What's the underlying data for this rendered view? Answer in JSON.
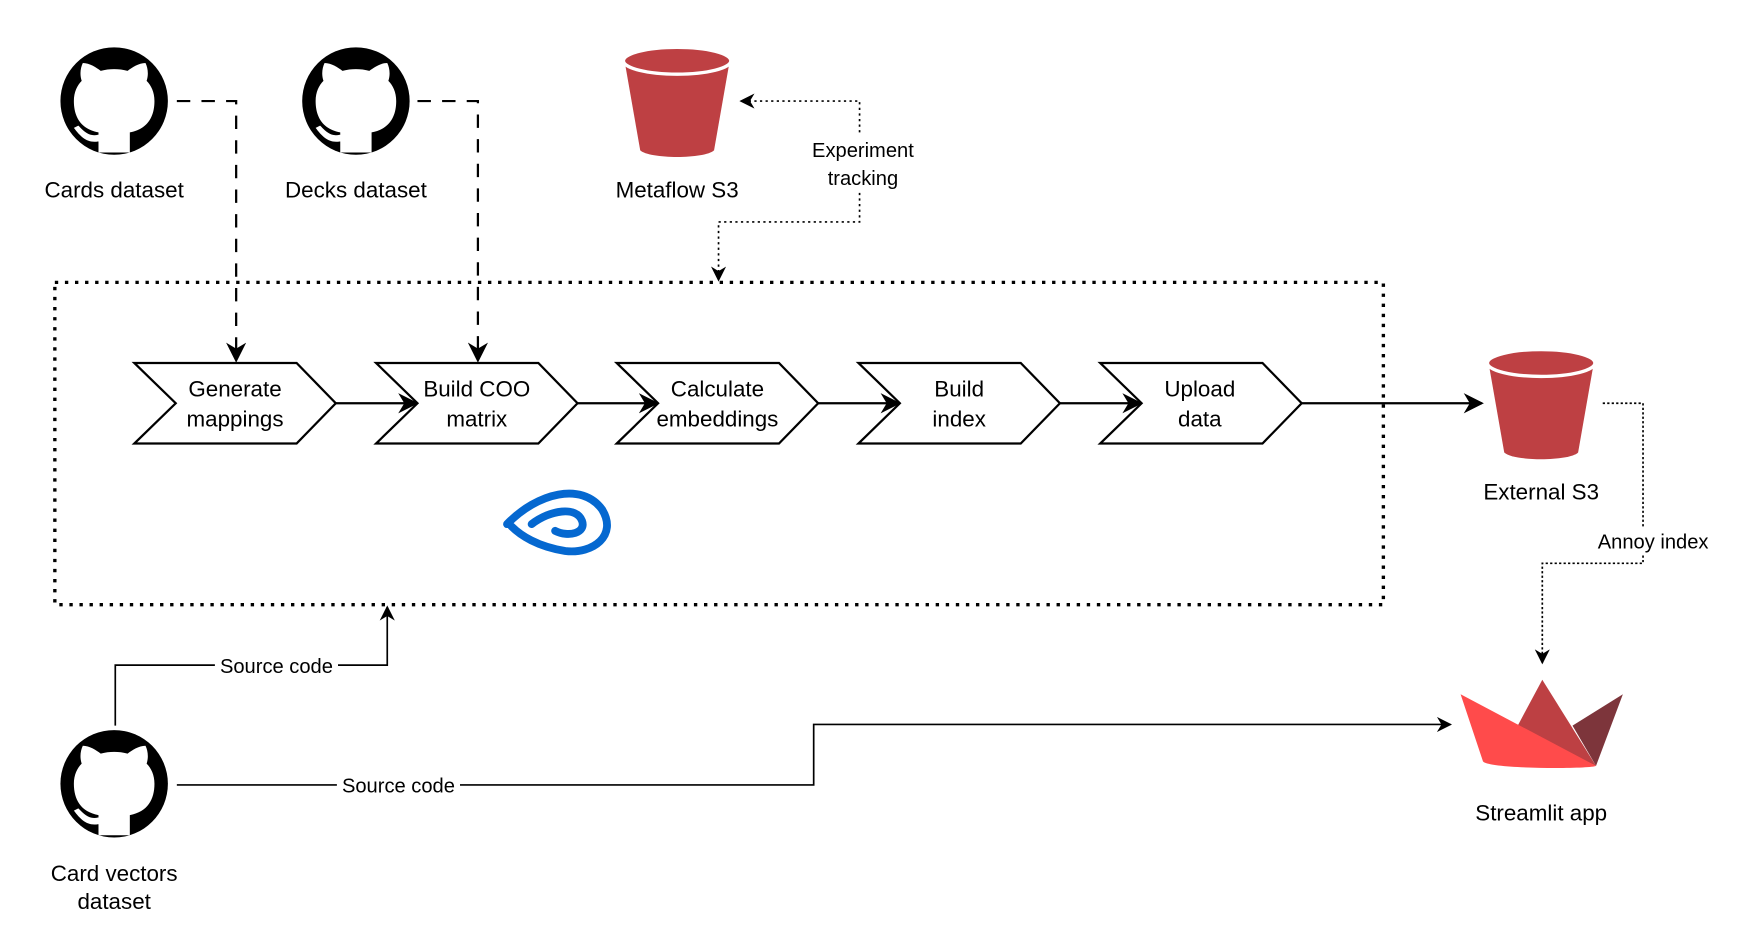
{
  "nodes": {
    "cards_dataset": {
      "label": "Cards dataset",
      "icon": "github-icon"
    },
    "decks_dataset": {
      "label": "Decks dataset",
      "icon": "github-icon"
    },
    "card_vectors_dataset": {
      "label_line1": "Card vectors",
      "label_line2": "dataset",
      "icon": "github-icon"
    },
    "metaflow_s3": {
      "label": "Metaflow S3",
      "icon": "s3-bucket-icon"
    },
    "external_s3": {
      "label": "External S3",
      "icon": "s3-bucket-icon"
    },
    "streamlit_app": {
      "label": "Streamlit app",
      "icon": "streamlit-icon"
    },
    "metaflow_logo": {
      "icon": "metaflow-logo-icon"
    }
  },
  "pipeline_steps": [
    {
      "line1": "Generate",
      "line2": "mappings"
    },
    {
      "line1": "Build COO",
      "line2": "matrix"
    },
    {
      "line1": "Calculate",
      "line2": "embeddings"
    },
    {
      "line1": "Build",
      "line2": "index"
    },
    {
      "line1": "Upload",
      "line2": "data"
    }
  ],
  "edges": {
    "experiment_tracking": {
      "line1": "Experiment",
      "line2": "tracking"
    },
    "annoy_index": "Annoy index",
    "source_code_flow": "Source code",
    "source_code_app": "Source code"
  },
  "colors": {
    "bucket": "#BE4043",
    "bucket_top": "#C84145",
    "metaflow_blue": "#0568D0",
    "streamlit_light": "#FF4B4B",
    "streamlit_mid": "#BD4043",
    "streamlit_dark": "#7D353B"
  }
}
